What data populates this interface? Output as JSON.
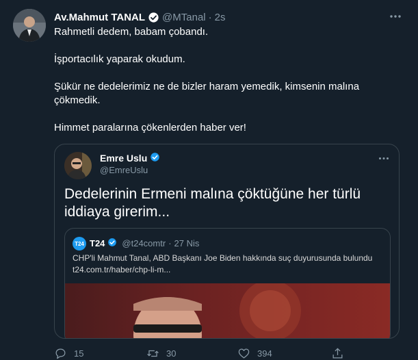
{
  "tweet": {
    "author_name": "Av.Mahmut TANAL",
    "handle": "@MTanal",
    "separator": "·",
    "time": "2s",
    "paragraphs": [
      "Rahmetli dedem, babam çobandı.",
      "İşportacılık yaparak okudum.",
      "Şükür ne dedelerimiz ne de bizler haram yemedik, kimsenin malına çökmedik.",
      "Himmet paralarına çökenlerden haber ver!"
    ]
  },
  "quote": {
    "author_name": "Emre Uslu",
    "handle": "@EmreUslu",
    "text": "Dedelerinin Ermeni malına çöktüğüne her türlü iddiaya girerim...",
    "inner": {
      "logo": "T24",
      "author_name": "T24",
      "handle": "@t24comtr",
      "separator": "·",
      "time": "27 Nis",
      "text": "CHP'li Mahmut Tanal, ABD Başkanı Joe Biden hakkında suç duyurusunda bulundu",
      "link": "t24.com.tr/haber/chp-li-m..."
    }
  },
  "actions": {
    "replies": "15",
    "retweets": "30",
    "likes": "394"
  },
  "icons": {
    "verified": "verified-badge-icon",
    "more": "more-horizontal-icon",
    "reply": "reply-icon",
    "retweet": "retweet-icon",
    "like": "heart-icon",
    "share": "share-icon"
  },
  "colors": {
    "background": "#15202b",
    "secondary_text": "#8899a6",
    "accent": "#1d9bf0",
    "border": "#38444d"
  }
}
